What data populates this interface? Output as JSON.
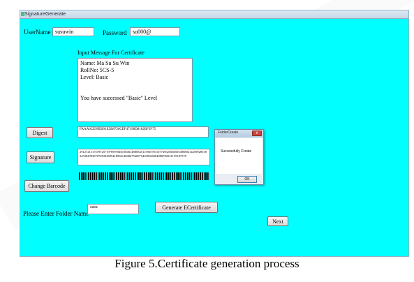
{
  "window": {
    "title": "SignatureGenerate"
  },
  "form": {
    "username_label": "UserName",
    "username_value": "susuwin",
    "password_label": "Password",
    "password_value": "su000@",
    "message_label": "Input Message For Certificate",
    "message_lines": [
      "Name: Ma Su Su Win",
      "RollNo: 5CS-5",
      "Level: Basic",
      "",
      "",
      "You have successed \"Basic\" Level"
    ],
    "digest_button": "Digest",
    "digest_value": "FAAA0CE99EB91E2B8720CEF47198D8182BF3F75",
    "signature_button": "Signature",
    "signature_value": "29127213175787257197899784615846148883451159657011677493256605054988021425992851834538299307072839469941893614608475609754358168284088782031195187578",
    "barcode_button": "Change Barcode",
    "folder_label": "Please Enter Folder Name",
    "folder_value": "susu",
    "generate_button": "Generate ECertificate",
    "next_button": "Next"
  },
  "dialog": {
    "title": "FolderCreate",
    "message": "Successfully Create",
    "ok": "OK",
    "close_glyph": "x"
  },
  "caption": "Figure 5.Certificate generation process"
}
